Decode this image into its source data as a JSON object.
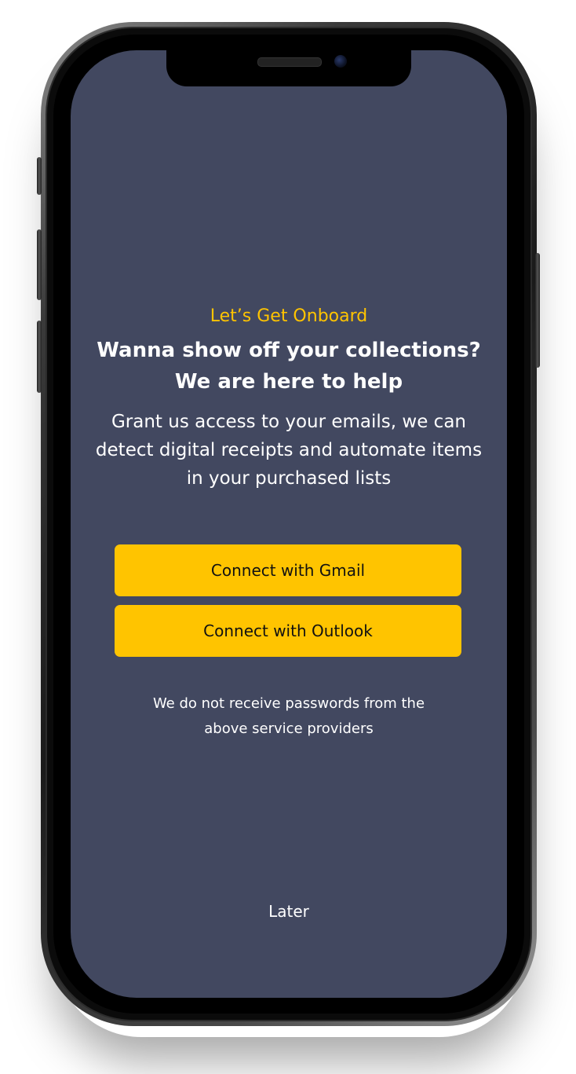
{
  "onboarding": {
    "eyebrow": "Let’s Get Onboard",
    "headline_line1": "Wanna show off your collections?",
    "headline_line2": "We are here to help",
    "description_line1": "Grant us access to your emails, we can",
    "description_line2": "detect digital receipts and automate items",
    "description_line3": "in your purchased lists",
    "gmail_button_label": "Connect with Gmail",
    "outlook_button_label": "Connect with Outlook",
    "note_line1": "We do not receive passwords from the",
    "note_line2": "above service providers",
    "later_label": "Later"
  },
  "colors": {
    "screen_background": "#424860",
    "accent": "#ffc400",
    "text": "#ffffff",
    "button_text": "#111111"
  }
}
